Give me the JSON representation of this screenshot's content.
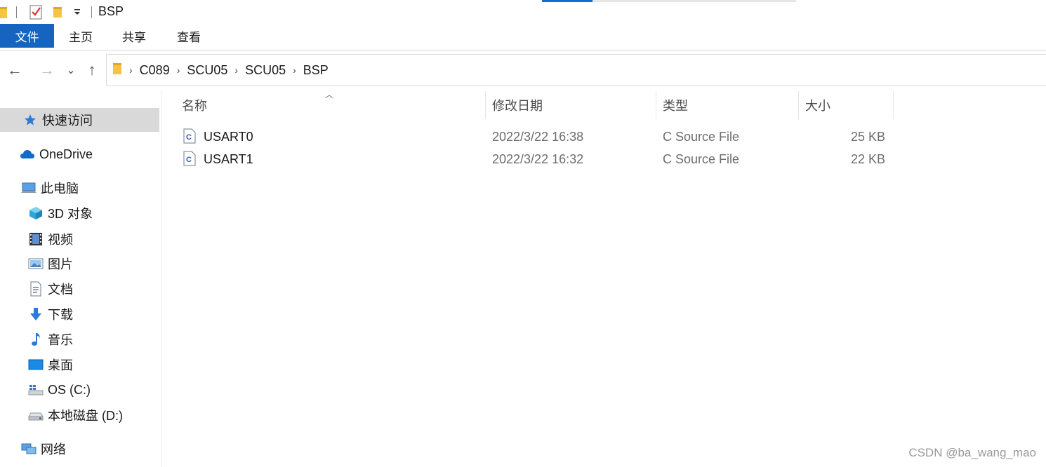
{
  "window": {
    "title": "BSP",
    "quick_access": [
      "folder-icon",
      "properties-check-icon",
      "new-folder-icon",
      "customize-dropdown-icon"
    ]
  },
  "ribbon": {
    "tabs": [
      "文件",
      "主页",
      "共享",
      "查看"
    ]
  },
  "nav": {
    "back": "←",
    "forward": "→",
    "recent": "⌄",
    "up": "↑"
  },
  "address": {
    "crumbs": [
      "C089",
      "SCU05",
      "SCU05",
      "BSP"
    ]
  },
  "sidebar": {
    "items": [
      {
        "label": "快速访问",
        "icon": "star-icon"
      },
      {
        "label": "OneDrive",
        "icon": "cloud-icon"
      },
      {
        "label": "此电脑",
        "icon": "computer-icon"
      },
      {
        "label": "3D 对象",
        "icon": "cube-3d-icon"
      },
      {
        "label": "视频",
        "icon": "film-icon"
      },
      {
        "label": "图片",
        "icon": "picture-icon"
      },
      {
        "label": "文档",
        "icon": "document-icon"
      },
      {
        "label": "下载",
        "icon": "download-arrow-icon"
      },
      {
        "label": "音乐",
        "icon": "music-note-icon"
      },
      {
        "label": "桌面",
        "icon": "desktop-icon"
      },
      {
        "label": "OS (C:)",
        "icon": "windows-drive-icon"
      },
      {
        "label": "本地磁盘 (D:)",
        "icon": "hard-drive-icon"
      },
      {
        "label": "网络",
        "icon": "network-icon"
      }
    ]
  },
  "columns": {
    "name": "名称",
    "modified": "修改日期",
    "type": "类型",
    "size": "大小"
  },
  "files": [
    {
      "name": "USART0",
      "modified": "2022/3/22 16:38",
      "type": "C Source File",
      "size": "25 KB",
      "icon": "c-source-file-icon"
    },
    {
      "name": "USART1",
      "modified": "2022/3/22 16:32",
      "type": "C Source File",
      "size": "22 KB",
      "icon": "c-source-file-icon"
    }
  ],
  "watermark": "CSDN @ba_wang_mao"
}
